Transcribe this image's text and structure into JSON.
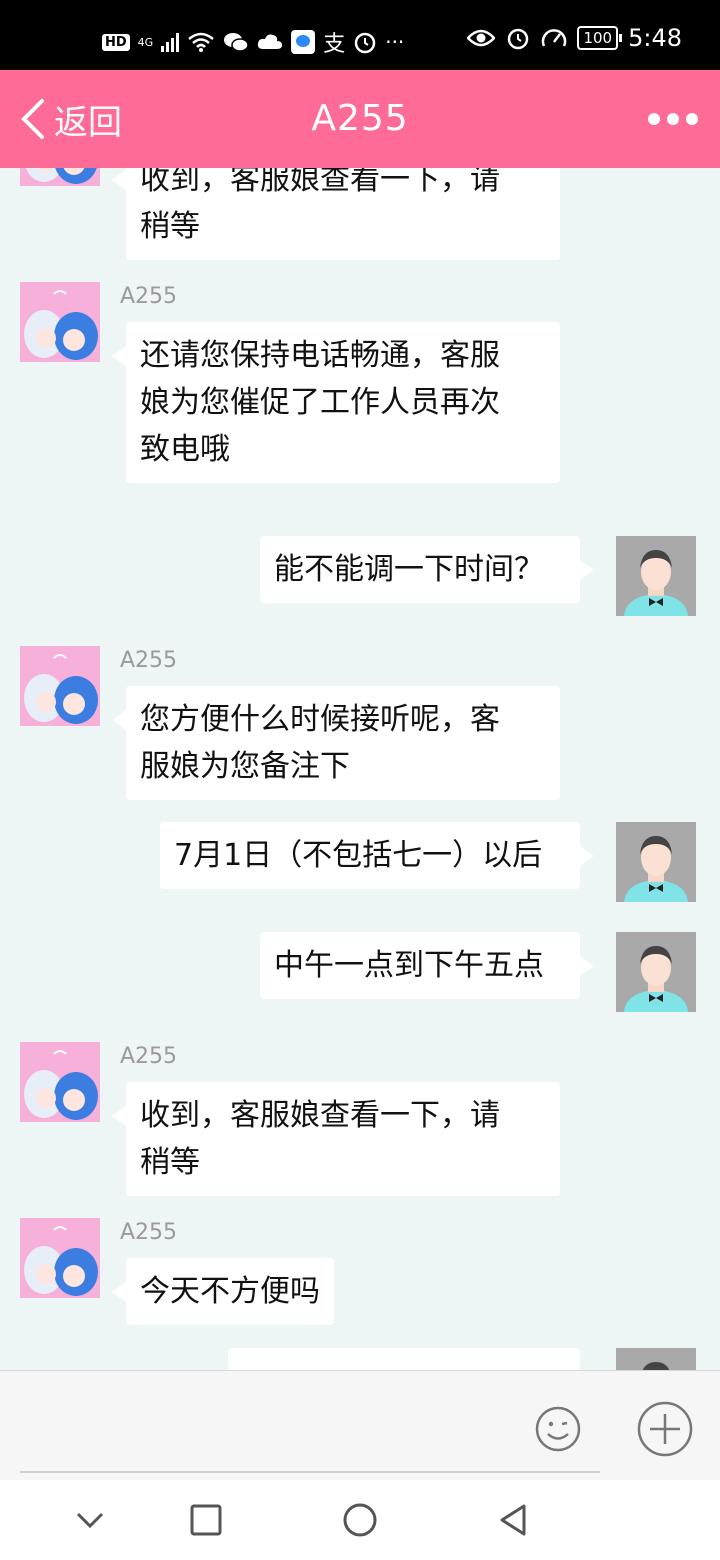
{
  "status_bar": {
    "time": "5:48",
    "battery": "100",
    "network_badge": "HD",
    "network_type": "4G",
    "icons": [
      "hd-icon",
      "signal-icon",
      "wifi-icon",
      "wechat-icon",
      "cloud-icon",
      "message-app-icon",
      "alipay-icon",
      "alarm-icon",
      "more-notifications-icon",
      "eye-icon",
      "alarm-icon",
      "speed-icon",
      "battery-icon"
    ]
  },
  "header": {
    "back_label": "返回",
    "title": "A255",
    "more_icon": "more-dots-icon",
    "background": "#fd6b96"
  },
  "messages": [
    {
      "side": "left",
      "sender": "",
      "text": "收到，客服娘查看一下，请\n稍等",
      "partial": true
    },
    {
      "side": "left",
      "sender": "A255",
      "text": "还请您保持电话畅通，客服\n娘为您催促了工作人员再次\n致电哦"
    },
    {
      "side": "right",
      "text": "能不能调一下时间？"
    },
    {
      "side": "left",
      "sender": "A255",
      "text": "您方便什么时候接听呢，客\n服娘为您备注下"
    },
    {
      "side": "right",
      "text": "7月1日（不包括七一）以后"
    },
    {
      "side": "right",
      "text": "中午一点到下午五点"
    },
    {
      "side": "left",
      "sender": "A255",
      "text": "收到，客服娘查看一下，请\n稍等"
    },
    {
      "side": "left",
      "sender": "A255",
      "text": "今天不方便吗"
    },
    {
      "side": "right",
      "text": "",
      "partial": true
    }
  ],
  "input_bar": {
    "value": "",
    "emoji_icon": "emoji-icon",
    "plus_icon": "plus-icon"
  },
  "nav_bar": {
    "icons": [
      "hide-keyboard-icon",
      "recents-icon",
      "home-icon",
      "back-icon"
    ]
  },
  "colors": {
    "chat_bg": "#eef5f5",
    "bubble": "#ffffff",
    "accent": "#fd6b96"
  }
}
